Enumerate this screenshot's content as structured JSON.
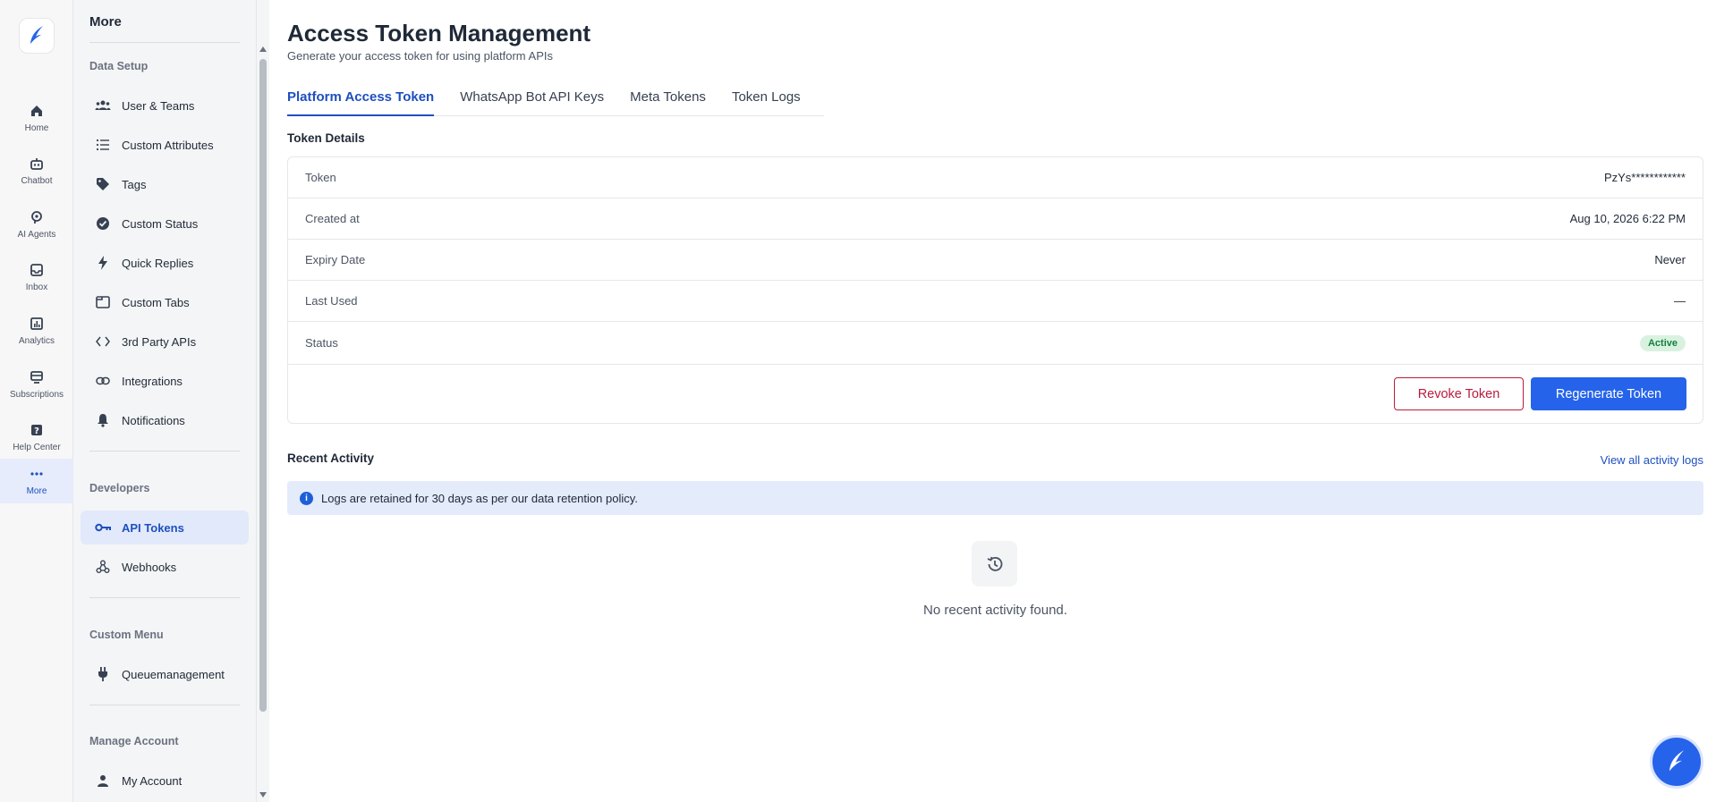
{
  "rail": {
    "items": [
      {
        "label": "Home",
        "icon": "home-icon"
      },
      {
        "label": "Chatbot",
        "icon": "robot-icon"
      },
      {
        "label": "AI Agents",
        "icon": "ai-agent-icon"
      },
      {
        "label": "Inbox",
        "icon": "inbox-icon"
      },
      {
        "label": "Analytics",
        "icon": "analytics-icon"
      },
      {
        "label": "Subscriptions",
        "icon": "subscriptions-icon"
      },
      {
        "label": "Help Center",
        "icon": "help-icon"
      },
      {
        "label": "More",
        "icon": "more-dots-icon",
        "active": true
      }
    ]
  },
  "subnav": {
    "title": "More",
    "sections": {
      "data_setup": "Data Setup",
      "developers": "Developers",
      "custom_menu": "Custom Menu",
      "manage_account": "Manage Account"
    },
    "items": {
      "users": "User & Teams",
      "attributes": "Custom Attributes",
      "tags": "Tags",
      "status": "Custom Status",
      "quick_replies": "Quick Replies",
      "custom_tabs": "Custom Tabs",
      "third_party": "3rd Party APIs",
      "integrations": "Integrations",
      "notifications": "Notifications",
      "api_tokens": "API Tokens",
      "webhooks": "Webhooks",
      "queue": "Queuemanagement",
      "my_account": "My Account"
    }
  },
  "page": {
    "title": "Access Token Management",
    "subtitle": "Generate your access token for using platform APIs"
  },
  "tabs": {
    "platform": "Platform Access Token",
    "whatsapp": "WhatsApp Bot API Keys",
    "meta": "Meta Tokens",
    "logs": "Token Logs"
  },
  "token": {
    "section_title": "Token Details",
    "token_label": "Token",
    "token_value": "PzYs************",
    "created_label": "Created at",
    "created_value": "Aug 10, 2026 6:22 PM",
    "expiry_label": "Expiry Date",
    "expiry_value": "Never",
    "last_used_label": "Last Used",
    "last_used_value": "—",
    "status_label": "Status",
    "status_value": "Active",
    "revoke_label": "Revoke Token",
    "regenerate_label": "Regenerate Token"
  },
  "activity": {
    "title": "Recent Activity",
    "view_all": "View all activity logs",
    "info": "Logs are retained for 30 days as per our data retention policy.",
    "empty": "No recent activity found."
  },
  "colors": {
    "accent": "#2563eb",
    "active_text": "#1e4fbf",
    "danger": "#b91c3c",
    "success": "#15803d"
  }
}
